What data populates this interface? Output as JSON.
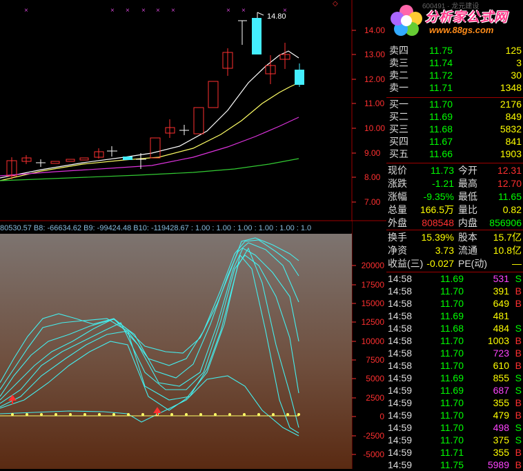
{
  "top_chart": {
    "price_axis_labels": [
      "14.00",
      "13.00",
      "12.00",
      "11.00",
      "10.00",
      "9.00",
      "8.00",
      "7.00"
    ],
    "high_marker": "14.80"
  },
  "indicator_bar": {
    "text": "80530.57  B8: -66634.62  B9: -99424.48  B10: -119428.67  : 1.00  : 1.00  : 1.00  : 1.00  : 1.00  : 1.0"
  },
  "bottom_chart": {
    "axis_labels": [
      "20000",
      "17500",
      "15000",
      "12500",
      "10000",
      "7500",
      "5000",
      "2500",
      "0",
      "-2500",
      "-5000"
    ]
  },
  "logo": {
    "title": "分析家公式网",
    "url": "www.88gs.com",
    "code": "600491 · 龙元建设"
  },
  "order_book": {
    "asks": [
      {
        "label": "卖四",
        "price": "11.75",
        "volume": "125"
      },
      {
        "label": "卖三",
        "price": "11.74",
        "volume": "3"
      },
      {
        "label": "卖二",
        "price": "11.72",
        "volume": "30"
      },
      {
        "label": "卖一",
        "price": "11.71",
        "volume": "1348"
      }
    ],
    "bids": [
      {
        "label": "买一",
        "price": "11.70",
        "volume": "2176"
      },
      {
        "label": "买二",
        "price": "11.69",
        "volume": "849"
      },
      {
        "label": "买三",
        "price": "11.68",
        "volume": "5832"
      },
      {
        "label": "买四",
        "price": "11.67",
        "volume": "841"
      },
      {
        "label": "买五",
        "price": "11.66",
        "volume": "1903"
      }
    ]
  },
  "quote": {
    "rows": [
      {
        "l1": "现价",
        "v1": "11.73",
        "l2": "今开",
        "v2": "12.31",
        "c1": "#00ff00",
        "c2": "#ff3030"
      },
      {
        "l1": "涨跌",
        "v1": "-1.21",
        "l2": "最高",
        "v2": "12.70",
        "c1": "#00ff00",
        "c2": "#ff3030"
      },
      {
        "l1": "涨幅",
        "v1": "-9.35%",
        "l2": "最低",
        "v2": "11.65",
        "c1": "#00ff00",
        "c2": "#00ff00"
      },
      {
        "l1": "总量",
        "v1": "166.5万",
        "l2": "量比",
        "v2": "0.82",
        "c1": "#ffff00",
        "c2": "#ffff00"
      },
      {
        "l1": "外盘",
        "v1": "808548",
        "l2": "内盘",
        "v2": "856906",
        "c1": "#ff3030",
        "c2": "#00ff00"
      }
    ]
  },
  "fundamentals": {
    "rows": [
      {
        "l1": "换手",
        "v1": "15.39%",
        "l2": "股本",
        "v2": "15.7亿"
      },
      {
        "l1": "净资",
        "v1": "3.73",
        "l2": "流通",
        "v2": "10.8亿"
      },
      {
        "l1": "收益(三)",
        "v1": "-0.027",
        "l2": "PE(动)",
        "v2": "—"
      }
    ]
  },
  "trades": [
    {
      "time": "14:58",
      "price": "11.69",
      "volume": "531",
      "side": "S"
    },
    {
      "time": "14:58",
      "price": "11.70",
      "volume": "391",
      "side": "B"
    },
    {
      "time": "14:58",
      "price": "11.70",
      "volume": "649",
      "side": "B"
    },
    {
      "time": "14:58",
      "price": "11.69",
      "volume": "481",
      "side": ""
    },
    {
      "time": "14:58",
      "price": "11.68",
      "volume": "484",
      "side": "S"
    },
    {
      "time": "14:58",
      "price": "11.70",
      "volume": "1003",
      "side": "B"
    },
    {
      "time": "14:58",
      "price": "11.70",
      "volume": "723",
      "side": "B"
    },
    {
      "time": "14:58",
      "price": "11.70",
      "volume": "610",
      "side": "B"
    },
    {
      "time": "14:59",
      "price": "11.69",
      "volume": "855",
      "side": "S"
    },
    {
      "time": "14:59",
      "price": "11.69",
      "volume": "687",
      "side": "S"
    },
    {
      "time": "14:59",
      "price": "11.70",
      "volume": "355",
      "side": "B"
    },
    {
      "time": "14:59",
      "price": "11.70",
      "volume": "479",
      "side": "B"
    },
    {
      "time": "14:59",
      "price": "11.70",
      "volume": "498",
      "side": "S"
    },
    {
      "time": "14:59",
      "price": "11.70",
      "volume": "375",
      "side": "S"
    },
    {
      "time": "14:59",
      "price": "11.71",
      "volume": "355",
      "side": "B"
    },
    {
      "time": "14:59",
      "price": "11.75",
      "volume": "5989",
      "side": "B"
    }
  ]
}
